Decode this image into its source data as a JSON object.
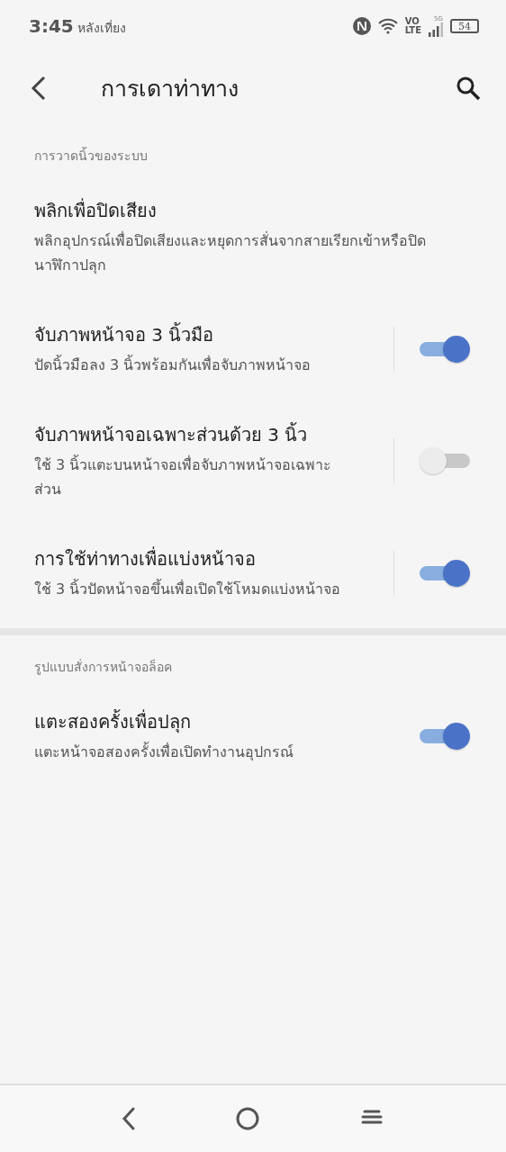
{
  "status_bar": {
    "time": "3:45",
    "period": "หลังเที่ยง",
    "volte_top": "VO",
    "volte_bottom": "LTE",
    "network": "5G",
    "battery": "54"
  },
  "app_bar": {
    "title": "การเดาท่าทาง"
  },
  "sections": [
    {
      "header": "การวาดนิ้วของระบบ",
      "items": [
        {
          "kind": "plain",
          "title": "พลิกเพื่อปิดเสียง",
          "summary": "พลิกอุปกรณ์เพื่อปิดเสียงและหยุดการสั่นจากสายเรียกเข้าหรือปิดนาฬิกาปลุก"
        },
        {
          "kind": "toggle",
          "title": "จับภาพหน้าจอ 3 นิ้วมือ",
          "summary": "ปัดนิ้วมือลง 3 นิ้วพร้อมกันเพื่อจับภาพหน้าจอ",
          "on": true,
          "separator": true
        },
        {
          "kind": "toggle",
          "title": "จับภาพหน้าจอเฉพาะส่วนด้วย 3 นิ้ว",
          "summary": "ใช้ 3 นิ้วแตะบนหน้าจอเพื่อจับภาพหน้าจอเฉพาะส่วน",
          "on": false,
          "separator": true
        },
        {
          "kind": "toggle",
          "title": "การใช้ท่าทางเพื่อแบ่งหน้าจอ",
          "summary": "ใช้ 3 นิ้วปัดหน้าจอขึ้นเพื่อเปิดใช้โหมดแบ่งหน้าจอ",
          "on": true,
          "separator": true
        }
      ]
    },
    {
      "header": "รูปแบบสั่งการหน้าจอล็อค",
      "items": [
        {
          "kind": "toggle",
          "title": "แตะสองครั้งเพื่อปลุก",
          "summary": "แตะหน้าจอสองครั้งเพื่อเปิดทำงานอุปกรณ์",
          "on": true,
          "separator": false
        }
      ]
    }
  ]
}
